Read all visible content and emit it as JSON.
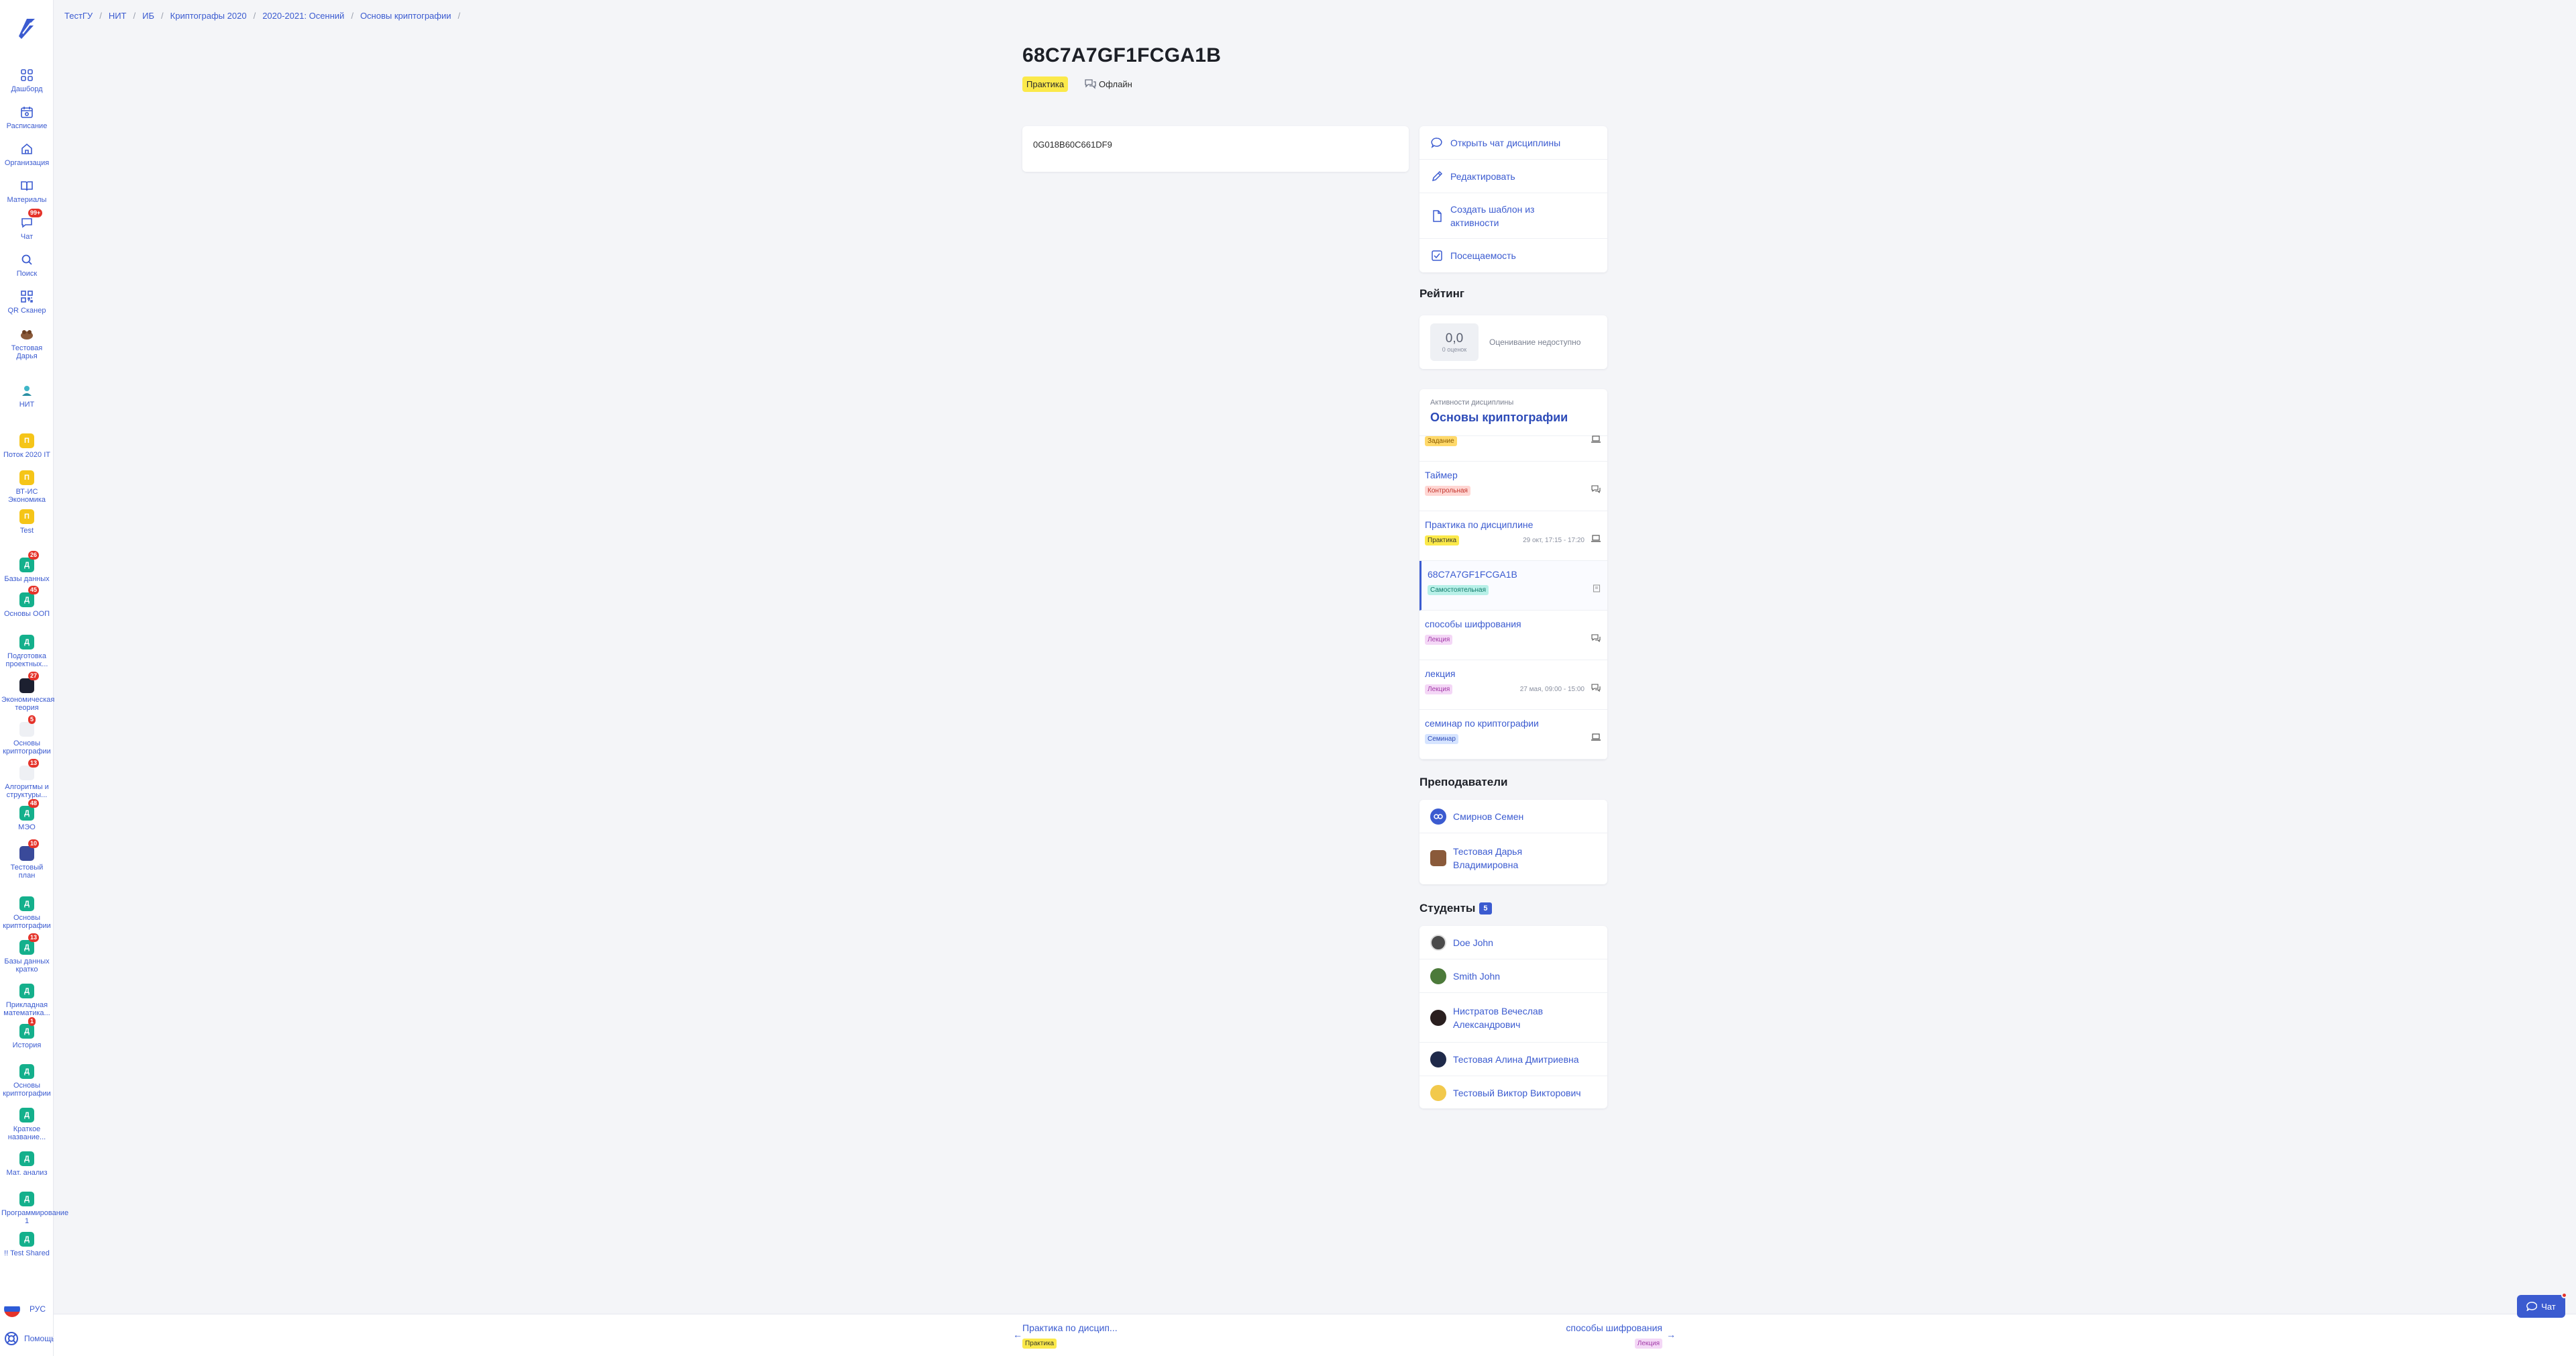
{
  "sidebar": {
    "items": [
      {
        "label": "Дашборд",
        "icon": "dashboard-icon"
      },
      {
        "label": "Расписание",
        "icon": "calendar-icon"
      },
      {
        "label": "Организация",
        "icon": "home-icon"
      },
      {
        "label": "Материалы",
        "icon": "book-icon"
      },
      {
        "label": "Чат",
        "icon": "chat-icon",
        "badge": "99+"
      },
      {
        "label": "Поиск",
        "icon": "search-icon"
      },
      {
        "label": "QR Сканер",
        "icon": "qr-icon"
      },
      {
        "label": "Тестовая Дарья",
        "icon": "user-avatar"
      },
      {
        "label": "НИТ",
        "icon": "org-icon"
      }
    ],
    "groups": [
      {
        "label": "Поток 2020 IT",
        "letter": "П",
        "color": "#f5c518"
      },
      {
        "label": "ВТ-ИС Экономика",
        "letter": "П",
        "color": "#f5c518"
      },
      {
        "label": "Test",
        "letter": "П",
        "color": "#f5c518"
      },
      {
        "label": "Базы данных",
        "letter": "Д",
        "color": "#14b08c",
        "badge": "26"
      },
      {
        "label": "Основы ООП",
        "letter": "Д",
        "color": "#14b08c",
        "badge": "45"
      },
      {
        "label": "Подготовка проектных...",
        "letter": "Д",
        "color": "#14b08c"
      },
      {
        "label": "Экономическая теория",
        "letter": "",
        "color": "#1c2030",
        "badge": "27"
      },
      {
        "label": "Основы криптографии",
        "letter": "",
        "color": "#eef0f4",
        "badge": "5"
      },
      {
        "label": "Алгоритмы и структуры...",
        "letter": "",
        "color": "#eef0f4",
        "badge": "13"
      },
      {
        "label": "МЭО",
        "letter": "Д",
        "color": "#14b08c",
        "badge": "48"
      },
      {
        "label": "Тестовый план",
        "letter": "",
        "color": "#3a4a9a",
        "badge": "10"
      },
      {
        "label": "Основы криптографии",
        "letter": "Д",
        "color": "#14b08c"
      },
      {
        "label": "Базы данных кратко",
        "letter": "Д",
        "color": "#14b08c",
        "badge": "13"
      },
      {
        "label": "Прикладная математика...",
        "letter": "Д",
        "color": "#14b08c"
      },
      {
        "label": "История",
        "letter": "Д",
        "color": "#14b08c",
        "badge": "1"
      },
      {
        "label": "Основы криптографии",
        "letter": "Д",
        "color": "#14b08c"
      },
      {
        "label": "Краткое название...",
        "letter": "Д",
        "color": "#14b08c"
      },
      {
        "label": "Мат. анализ",
        "letter": "Д",
        "color": "#14b08c"
      },
      {
        "label": "Программирование 1",
        "letter": "Д",
        "color": "#14b08c"
      },
      {
        "label": "!! Test Shared",
        "letter": "Д",
        "color": "#14b08c"
      }
    ],
    "language": "РУС",
    "help": "Помощь"
  },
  "breadcrumb": [
    "ТестГУ",
    "НИТ",
    "ИБ",
    "Криптографы 2020",
    "2020-2021: Осенний",
    "Основы криптографии"
  ],
  "header": {
    "title": "68C7A7GF1FCGA1B",
    "type_tag": "Практика",
    "mode": "Офлайн"
  },
  "content": {
    "text": "0G018B60C661DF9"
  },
  "actions": [
    {
      "label": "Открыть чат дисциплины",
      "icon": "chat-bubble-icon"
    },
    {
      "label": "Редактировать",
      "icon": "pencil-icon"
    },
    {
      "label": "Создать шаблон из активности",
      "icon": "file-icon"
    },
    {
      "label": "Посещаемость",
      "icon": "checkbox-icon"
    }
  ],
  "rating": {
    "title": "Рейтинг",
    "score": "0,0",
    "score_sub": "0 оценок",
    "note": "Оценивание недоступно"
  },
  "discipline": {
    "subtitle": "Активности дисциплины",
    "name": "Основы криптографии",
    "activities": [
      {
        "title": "",
        "tag": "Задание",
        "tag_class": "tag-task",
        "time": "",
        "icon": "laptop-icon"
      },
      {
        "title": "Таймер",
        "tag": "Контрольная",
        "tag_class": "tag-control",
        "time": "",
        "icon": "chat-icon"
      },
      {
        "title": "Практика по дисциплине",
        "tag": "Практика",
        "tag_class": "tag-practice",
        "time": "29 окт, 17:15 - 17:20",
        "icon": "laptop-icon"
      },
      {
        "title": "68C7A7GF1FCGA1B",
        "tag": "Самостоятельная",
        "tag_class": "tag-self",
        "time": "",
        "icon": "book-icon",
        "active": true
      },
      {
        "title": "способы шифрования",
        "tag": "Лекция",
        "tag_class": "tag-lecture",
        "time": "",
        "icon": "chat-icon"
      },
      {
        "title": "лекция",
        "tag": "Лекция",
        "tag_class": "tag-lecture",
        "time": "27 мая, 09:00 - 15:00",
        "icon": "chat-icon"
      },
      {
        "title": "семинар по криптографии",
        "tag": "Семинар",
        "tag_class": "tag-seminar",
        "time": "",
        "icon": "laptop-icon"
      }
    ]
  },
  "teachers": {
    "title": "Преподаватели",
    "list": [
      "Смирнов Семен",
      "Тестовая Дарья Владимировна"
    ]
  },
  "students": {
    "title": "Студенты",
    "count": "5",
    "list": [
      "Doe John",
      "Smith John",
      "Нистратов Вечеслав Александрович",
      "Тестовая Алина Дмитриевна",
      "Тестовый Виктор Викторович"
    ]
  },
  "bottom_nav": {
    "prev": {
      "label": "Практика по дисцип...",
      "tag": "Практика"
    },
    "next": {
      "label": "способы шифрования",
      "tag": "Лекция"
    }
  },
  "chat_button": "Чат",
  "colors": {
    "accent": "#3b5bd0",
    "practice": "#fbe94a",
    "background": "#f4f5f8"
  }
}
